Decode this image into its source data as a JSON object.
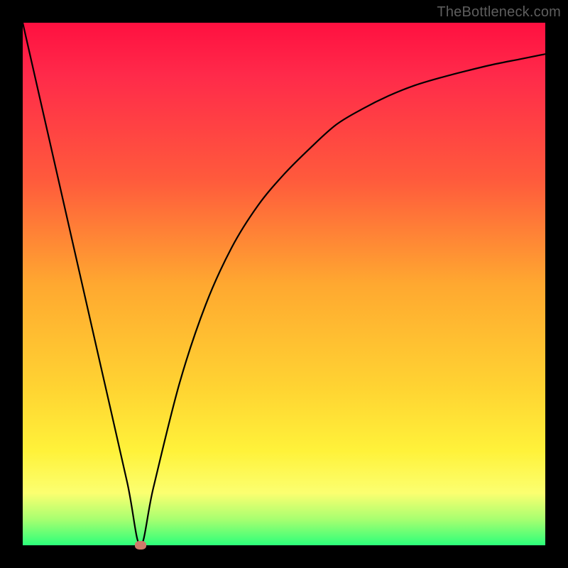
{
  "attribution": "TheBottleneck.com",
  "chart_data": {
    "type": "line",
    "title": "",
    "xlabel": "",
    "ylabel": "",
    "xlim": [
      0,
      100
    ],
    "ylim": [
      0,
      100
    ],
    "x": [
      0,
      5,
      10,
      15,
      20,
      22.5,
      25,
      30,
      35,
      40,
      45,
      50,
      55,
      60,
      65,
      70,
      75,
      80,
      85,
      90,
      95,
      100
    ],
    "values": [
      100,
      78,
      56,
      34,
      12,
      0,
      11,
      31,
      46,
      57,
      65,
      71,
      76,
      80.5,
      83.5,
      86,
      88,
      89.5,
      90.8,
      92,
      93,
      94
    ],
    "marker": {
      "x": 22.5,
      "y": 0,
      "color": "#cf7a6a"
    },
    "background_gradient": {
      "direction": "top-to-bottom",
      "stops": [
        {
          "pos": 0,
          "color": "#ff1040"
        },
        {
          "pos": 50,
          "color": "#ffa830"
        },
        {
          "pos": 82,
          "color": "#fff23a"
        },
        {
          "pos": 100,
          "color": "#2cff7a"
        }
      ]
    }
  }
}
